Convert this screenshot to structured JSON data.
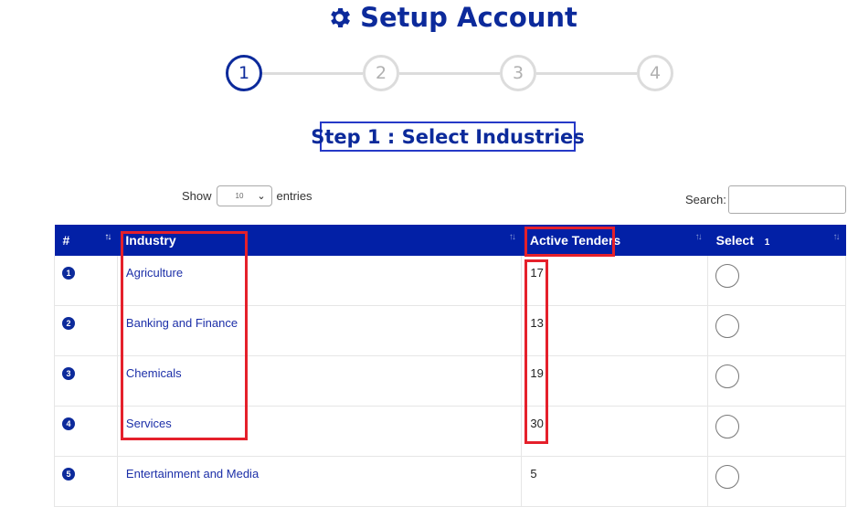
{
  "header": {
    "title": "Setup Account",
    "icon": "gear-icon",
    "brand_color": "#0c2a9b"
  },
  "stepper": {
    "steps": [
      "1",
      "2",
      "3",
      "4"
    ],
    "active": 1
  },
  "step_heading": "Step 1 : Select Industries",
  "controls": {
    "show_label": "Show",
    "show_value": "10",
    "entries_label": "entries",
    "search_label": "Search:",
    "search_value": ""
  },
  "table": {
    "columns": [
      "#",
      "Industry",
      "Active Tenders",
      "Select"
    ],
    "select_sub": "1",
    "header_color": "#0220a6",
    "rows": [
      {
        "rank": "1",
        "industry": "Agriculture",
        "tenders": "17"
      },
      {
        "rank": "2",
        "industry": "Banking and Finance",
        "tenders": "13"
      },
      {
        "rank": "3",
        "industry": "Chemicals",
        "tenders": "19"
      },
      {
        "rank": "4",
        "industry": "Services",
        "tenders": "30"
      },
      {
        "rank": "5",
        "industry": "Entertainment and Media",
        "tenders": "5"
      }
    ]
  },
  "annotation_color": "#e5202b"
}
